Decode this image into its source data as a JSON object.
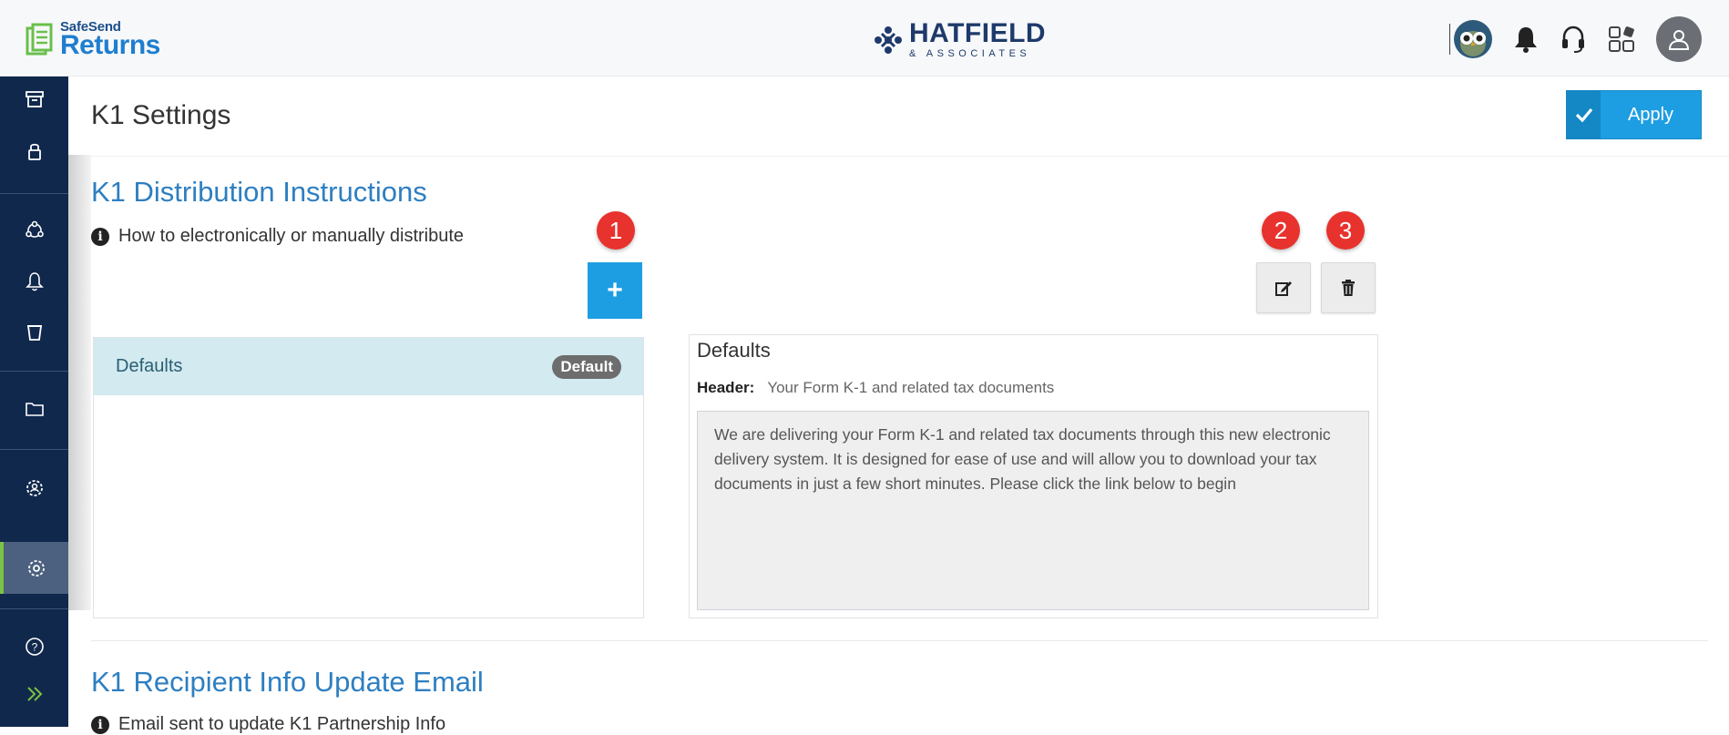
{
  "brand": {
    "small": "SafeSend",
    "big": "Returns"
  },
  "company": {
    "name": "HATFIELD",
    "sub": "& ASSOCIATES"
  },
  "top_icons": [
    "owl-avatar-icon",
    "bell-icon",
    "headset-icon",
    "apps-grid-icon",
    "user-avatar-icon"
  ],
  "sidebar": {
    "items": [
      "archive-icon",
      "lock-icon",
      "users-network-icon",
      "bell-icon",
      "trash-can-icon",
      "folder-icon",
      "gear-users-icon",
      "settings-icon",
      "help-icon",
      "expand-icon"
    ],
    "active": "settings-icon",
    "accent": "#7cc243"
  },
  "page": {
    "title": "K1 Settings",
    "apply_label": "Apply"
  },
  "section1": {
    "title": "K1 Distribution Instructions",
    "info": "How to electronically or manually distribute",
    "add_label": "+",
    "callouts": [
      "1",
      "2",
      "3"
    ],
    "list": [
      {
        "label": "Defaults",
        "badge": "Default",
        "selected": true
      }
    ],
    "detail": {
      "title": "Defaults",
      "header_label": "Header:",
      "header_value": "Your Form K-1 and related tax documents",
      "body": "We are delivering your Form K-1 and related tax documents through this new electronic delivery system. It is designed for ease of use and will allow you to download your tax documents in just a few short minutes. Please click the link below to begin"
    }
  },
  "section2": {
    "title": "K1 Recipient Info Update Email",
    "info": "Email sent to update K1 Partnership Info"
  },
  "colors": {
    "primary": "#1e9ee2",
    "sidebar": "#10284c",
    "title_blue": "#2e7fc1",
    "callout_red": "#e8322e"
  }
}
